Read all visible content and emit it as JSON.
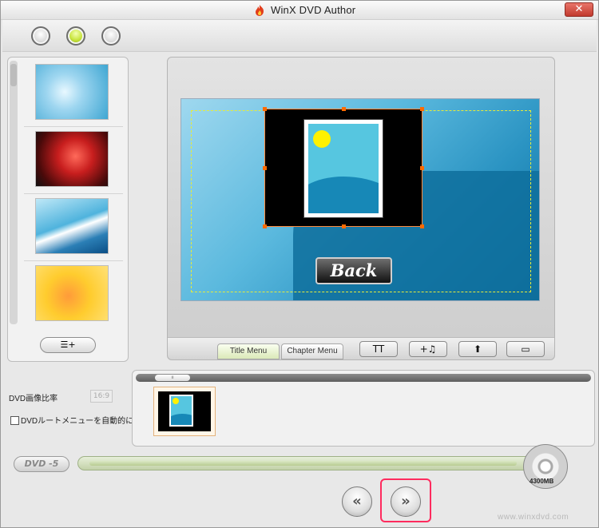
{
  "window": {
    "title": "WinX DVD Author",
    "close_label": "✕",
    "accent": "#c7e43c",
    "highlight_color": "#ff2b5e"
  },
  "top_buttons": [
    {
      "name": "step-1-button",
      "active": false
    },
    {
      "name": "step-2-button",
      "active": true
    },
    {
      "name": "step-3-button",
      "active": false
    }
  ],
  "sidebar": {
    "backgrounds": [
      {
        "name": "bg-blue-sparkle"
      },
      {
        "name": "bg-red-roses"
      },
      {
        "name": "bg-blue-waves"
      },
      {
        "name": "bg-yellow-flowers"
      }
    ],
    "add_button_icon": "add-list-icon",
    "add_button_label": "☰+"
  },
  "preview": {
    "back_button_label": "Back",
    "frame_color": "#ff8a3c",
    "safe_area_color": "#e6ec3a"
  },
  "tabs": [
    {
      "label": "Title Menu",
      "active": true
    },
    {
      "label": "Chapter Menu",
      "active": false
    }
  ],
  "tools": [
    {
      "name": "text-tool-button",
      "label": "TT",
      "icon": "text-icon"
    },
    {
      "name": "add-music-button",
      "label": "+♫",
      "icon": "music-icon"
    },
    {
      "name": "move-up-button",
      "label": "⬆",
      "icon": "arrow-up-icon"
    },
    {
      "name": "keyboard-button",
      "label": "▭",
      "icon": "keyboard-icon"
    }
  ],
  "settings": {
    "aspect_label": "DVD画像比率",
    "aspect_value": "16:9",
    "auto_menu_label": "DVDルートメニューを自動的に添加する",
    "auto_menu_checked": false
  },
  "timeline": {
    "scroll_thumb_label": "ıı"
  },
  "capacity": {
    "disc_type": "DVD -5",
    "capacity_label": "4300MB",
    "used_fraction": 0.97
  },
  "nav": {
    "back_label": "«",
    "next_label": "»"
  },
  "watermark": "www.winxdvd.com"
}
